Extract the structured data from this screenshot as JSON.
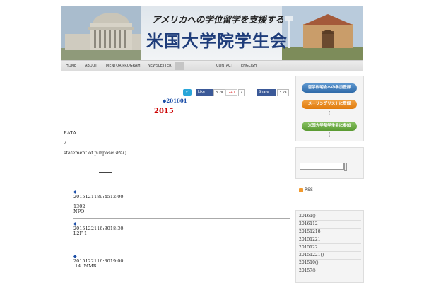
{
  "header": {
    "tagline": "アメリカへの学位留学を支援する",
    "title": "米国大学院学生会"
  },
  "nav": {
    "items": [
      "HOME",
      "ABOUT",
      "MENTOR PROGRAM",
      "NEWSLETTER",
      "CONTACT",
      "ENGLISH"
    ]
  },
  "social": {
    "fb_like": "Like",
    "fb_like_count": "3.2K",
    "gplus": "G+1",
    "gplus_count": "7",
    "fb_share": "Share",
    "fb_share_count": "3.2K"
  },
  "post": {
    "date": "◆201601",
    "year": "2015",
    "para1": "RATA",
    "para2": "2",
    "para3": "statement of purposeGPA()",
    "underline": "_____"
  },
  "events": [
    {
      "mark": "◆",
      "text": "2015121189:4512:00\n\n1302\nNPO"
    },
    {
      "mark": "◆___",
      "text": "2015122116:3018:30\nL2F 1"
    },
    {
      "mark": "◆",
      "text": "2015122116:3019:00\n 14  MMR"
    }
  ],
  "sidebar": {
    "btn_register": "留学説明会への参加登録",
    "btn_mailing": "メーリングリストに登録",
    "btn_join": "米国大学院学生会に参加",
    "paren1": "(",
    "paren2": "(",
    "rss": "RSS",
    "archives": [
      "20161()",
      "2016112",
      "20151218",
      "20151221",
      "2015122",
      "20151221()",
      "201510()",
      "20157()"
    ]
  }
}
